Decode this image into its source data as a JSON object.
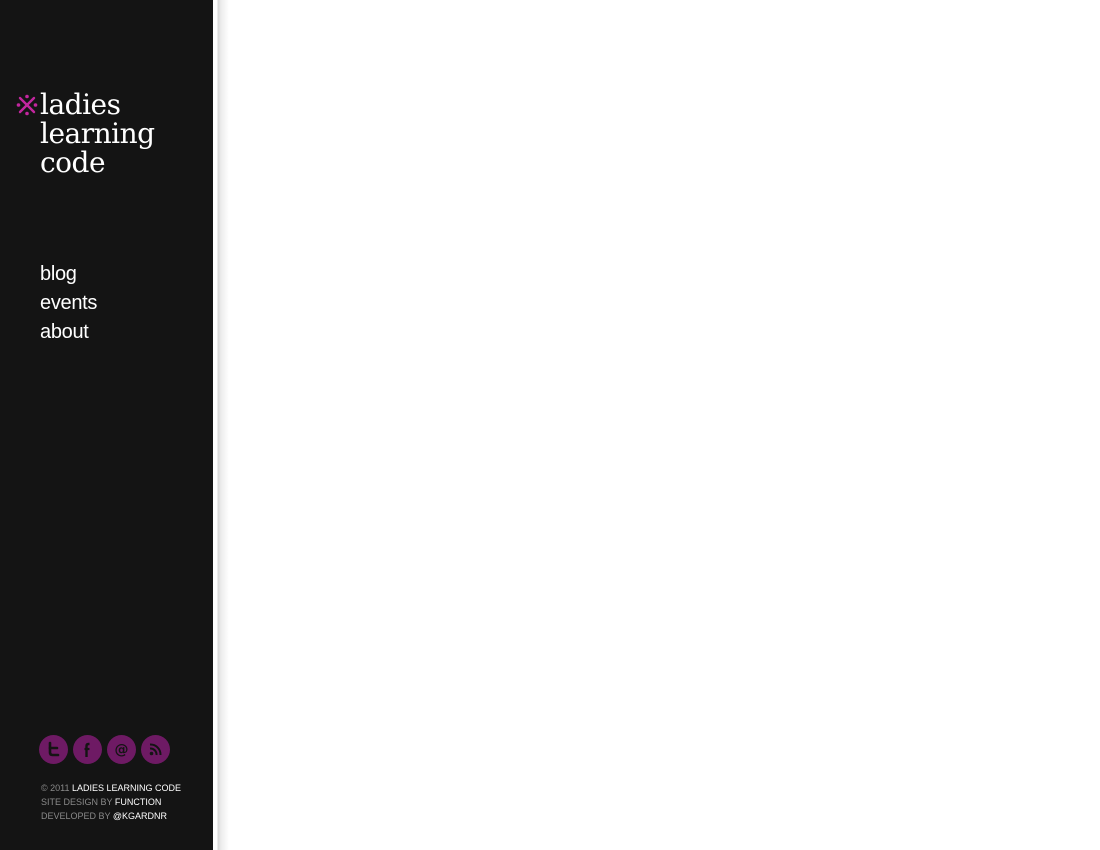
{
  "sidebar": {
    "logo": {
      "lines": [
        "ladies",
        "learning",
        "code"
      ]
    },
    "nav": [
      {
        "label": "blog"
      },
      {
        "label": "events"
      },
      {
        "label": "about"
      }
    ],
    "social": [
      {
        "icon": "twitter-icon"
      },
      {
        "icon": "facebook-icon"
      },
      {
        "icon": "email-icon"
      },
      {
        "icon": "rss-icon"
      }
    ],
    "footer": {
      "copyright_prefix": "© 2011",
      "copyright_name": "LADIES LEARNING CODE",
      "design_prefix": "SITE DESIGN BY",
      "design_name": "FUNCTION",
      "dev_prefix": "DEVELOPED BY",
      "dev_name": "@KGARDNR"
    }
  },
  "colors": {
    "sidebar_bg": "#141414",
    "accent_pink": "#c2269e",
    "social_purple": "#6e1a64",
    "text_white": "#ffffff",
    "text_muted": "#8a8a8a",
    "main_bg": "#ffffff"
  }
}
